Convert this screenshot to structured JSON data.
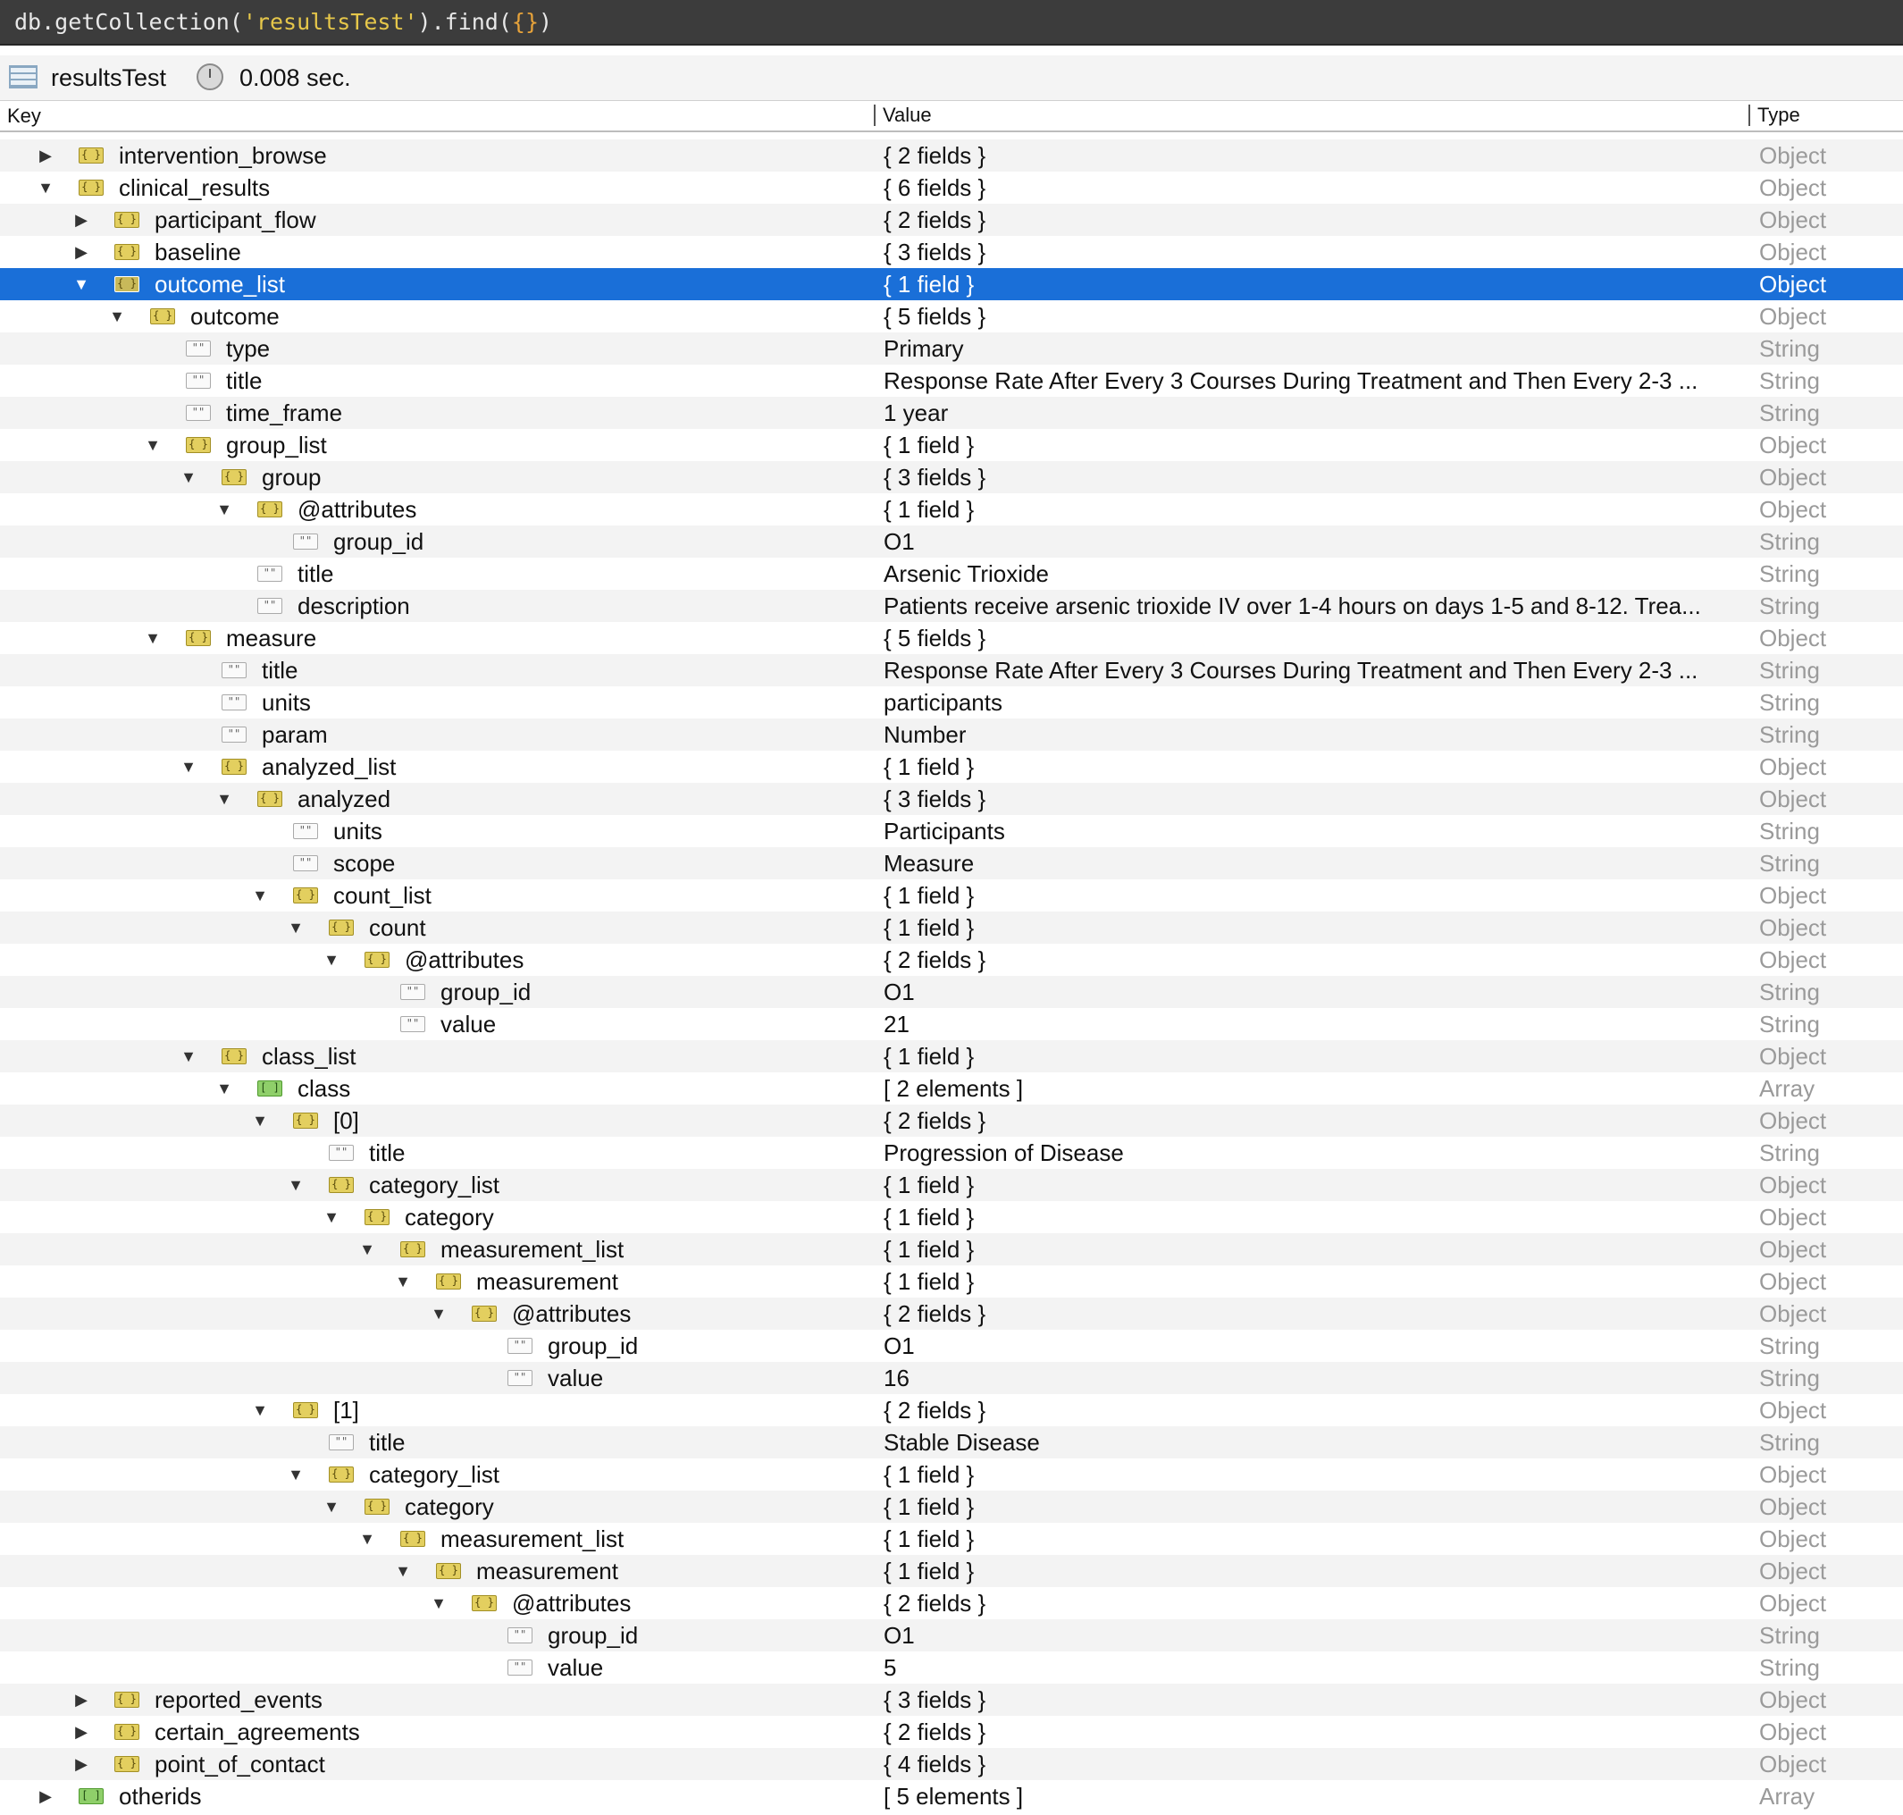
{
  "query": {
    "prefix": "db.getCollection(",
    "collection": "'resultsTest'",
    "suffix": ").find(",
    "braces": "{}",
    "close": ")"
  },
  "status": {
    "collection_name": "resultsTest",
    "elapsed": "0.008 sec."
  },
  "columns": {
    "key": "Key",
    "value": "Value",
    "type": "Type"
  },
  "rows": [
    {
      "key": "intervention_browse",
      "value": "{ 2 fields }",
      "type": "Object",
      "depth": 1,
      "kind": "object",
      "state": "collapsed"
    },
    {
      "key": "clinical_results",
      "value": "{ 6 fields }",
      "type": "Object",
      "depth": 1,
      "kind": "object",
      "state": "expanded"
    },
    {
      "key": "participant_flow",
      "value": "{ 2 fields }",
      "type": "Object",
      "depth": 2,
      "kind": "object",
      "state": "collapsed"
    },
    {
      "key": "baseline",
      "value": "{ 3 fields }",
      "type": "Object",
      "depth": 2,
      "kind": "object",
      "state": "collapsed"
    },
    {
      "key": "outcome_list",
      "value": "{ 1 field }",
      "type": "Object",
      "depth": 2,
      "kind": "object",
      "state": "expanded",
      "selected": true
    },
    {
      "key": "outcome",
      "value": "{ 5 fields }",
      "type": "Object",
      "depth": 3,
      "kind": "object",
      "state": "expanded"
    },
    {
      "key": "type",
      "value": "Primary",
      "type": "String",
      "depth": 4,
      "kind": "string",
      "state": "leaf"
    },
    {
      "key": "title",
      "value": "Response Rate After Every 3 Courses During Treatment and Then Every 2-3 ...",
      "type": "String",
      "depth": 4,
      "kind": "string",
      "state": "leaf"
    },
    {
      "key": "time_frame",
      "value": "1 year",
      "type": "String",
      "depth": 4,
      "kind": "string",
      "state": "leaf"
    },
    {
      "key": "group_list",
      "value": "{ 1 field }",
      "type": "Object",
      "depth": 4,
      "kind": "object",
      "state": "expanded"
    },
    {
      "key": "group",
      "value": "{ 3 fields }",
      "type": "Object",
      "depth": 5,
      "kind": "object",
      "state": "expanded"
    },
    {
      "key": "@attributes",
      "value": "{ 1 field }",
      "type": "Object",
      "depth": 6,
      "kind": "object",
      "state": "expanded"
    },
    {
      "key": "group_id",
      "value": "O1",
      "type": "String",
      "depth": 7,
      "kind": "string",
      "state": "leaf"
    },
    {
      "key": "title",
      "value": "Arsenic Trioxide",
      "type": "String",
      "depth": 6,
      "kind": "string",
      "state": "leaf"
    },
    {
      "key": "description",
      "value": "Patients receive arsenic trioxide IV over 1-4 hours on days 1-5 and 8-12. Trea...",
      "type": "String",
      "depth": 6,
      "kind": "string",
      "state": "leaf"
    },
    {
      "key": "measure",
      "value": "{ 5 fields }",
      "type": "Object",
      "depth": 4,
      "kind": "object",
      "state": "expanded"
    },
    {
      "key": "title",
      "value": "Response Rate After Every 3 Courses During Treatment and Then Every 2-3 ...",
      "type": "String",
      "depth": 5,
      "kind": "string",
      "state": "leaf"
    },
    {
      "key": "units",
      "value": "participants",
      "type": "String",
      "depth": 5,
      "kind": "string",
      "state": "leaf"
    },
    {
      "key": "param",
      "value": "Number",
      "type": "String",
      "depth": 5,
      "kind": "string",
      "state": "leaf"
    },
    {
      "key": "analyzed_list",
      "value": "{ 1 field }",
      "type": "Object",
      "depth": 5,
      "kind": "object",
      "state": "expanded"
    },
    {
      "key": "analyzed",
      "value": "{ 3 fields }",
      "type": "Object",
      "depth": 6,
      "kind": "object",
      "state": "expanded"
    },
    {
      "key": "units",
      "value": "Participants",
      "type": "String",
      "depth": 7,
      "kind": "string",
      "state": "leaf"
    },
    {
      "key": "scope",
      "value": "Measure",
      "type": "String",
      "depth": 7,
      "kind": "string",
      "state": "leaf"
    },
    {
      "key": "count_list",
      "value": "{ 1 field }",
      "type": "Object",
      "depth": 7,
      "kind": "object",
      "state": "expanded"
    },
    {
      "key": "count",
      "value": "{ 1 field }",
      "type": "Object",
      "depth": 8,
      "kind": "object",
      "state": "expanded"
    },
    {
      "key": "@attributes",
      "value": "{ 2 fields }",
      "type": "Object",
      "depth": 9,
      "kind": "object",
      "state": "expanded"
    },
    {
      "key": "group_id",
      "value": "O1",
      "type": "String",
      "depth": 10,
      "kind": "string",
      "state": "leaf"
    },
    {
      "key": "value",
      "value": "21",
      "type": "String",
      "depth": 10,
      "kind": "string",
      "state": "leaf"
    },
    {
      "key": "class_list",
      "value": "{ 1 field }",
      "type": "Object",
      "depth": 5,
      "kind": "object",
      "state": "expanded"
    },
    {
      "key": "class",
      "value": "[ 2 elements ]",
      "type": "Array",
      "depth": 6,
      "kind": "array",
      "state": "expanded"
    },
    {
      "key": "[0]",
      "value": "{ 2 fields }",
      "type": "Object",
      "depth": 7,
      "kind": "object",
      "state": "expanded"
    },
    {
      "key": "title",
      "value": "Progression of Disease",
      "type": "String",
      "depth": 8,
      "kind": "string",
      "state": "leaf"
    },
    {
      "key": "category_list",
      "value": "{ 1 field }",
      "type": "Object",
      "depth": 8,
      "kind": "object",
      "state": "expanded"
    },
    {
      "key": "category",
      "value": "{ 1 field }",
      "type": "Object",
      "depth": 9,
      "kind": "object",
      "state": "expanded"
    },
    {
      "key": "measurement_list",
      "value": "{ 1 field }",
      "type": "Object",
      "depth": 10,
      "kind": "object",
      "state": "expanded"
    },
    {
      "key": "measurement",
      "value": "{ 1 field }",
      "type": "Object",
      "depth": 11,
      "kind": "object",
      "state": "expanded"
    },
    {
      "key": "@attributes",
      "value": "{ 2 fields }",
      "type": "Object",
      "depth": 12,
      "kind": "object",
      "state": "expanded"
    },
    {
      "key": "group_id",
      "value": "O1",
      "type": "String",
      "depth": 13,
      "kind": "string",
      "state": "leaf"
    },
    {
      "key": "value",
      "value": "16",
      "type": "String",
      "depth": 13,
      "kind": "string",
      "state": "leaf"
    },
    {
      "key": "[1]",
      "value": "{ 2 fields }",
      "type": "Object",
      "depth": 7,
      "kind": "object",
      "state": "expanded"
    },
    {
      "key": "title",
      "value": "Stable Disease",
      "type": "String",
      "depth": 8,
      "kind": "string",
      "state": "leaf"
    },
    {
      "key": "category_list",
      "value": "{ 1 field }",
      "type": "Object",
      "depth": 8,
      "kind": "object",
      "state": "expanded"
    },
    {
      "key": "category",
      "value": "{ 1 field }",
      "type": "Object",
      "depth": 9,
      "kind": "object",
      "state": "expanded"
    },
    {
      "key": "measurement_list",
      "value": "{ 1 field }",
      "type": "Object",
      "depth": 10,
      "kind": "object",
      "state": "expanded"
    },
    {
      "key": "measurement",
      "value": "{ 1 field }",
      "type": "Object",
      "depth": 11,
      "kind": "object",
      "state": "expanded"
    },
    {
      "key": "@attributes",
      "value": "{ 2 fields }",
      "type": "Object",
      "depth": 12,
      "kind": "object",
      "state": "expanded"
    },
    {
      "key": "group_id",
      "value": "O1",
      "type": "String",
      "depth": 13,
      "kind": "string",
      "state": "leaf"
    },
    {
      "key": "value",
      "value": "5",
      "type": "String",
      "depth": 13,
      "kind": "string",
      "state": "leaf"
    },
    {
      "key": "reported_events",
      "value": "{ 3 fields }",
      "type": "Object",
      "depth": 2,
      "kind": "object",
      "state": "collapsed"
    },
    {
      "key": "certain_agreements",
      "value": "{ 2 fields }",
      "type": "Object",
      "depth": 2,
      "kind": "object",
      "state": "collapsed"
    },
    {
      "key": "point_of_contact",
      "value": "{ 4 fields }",
      "type": "Object",
      "depth": 2,
      "kind": "object",
      "state": "collapsed"
    },
    {
      "key": "otherids",
      "value": "[ 5 elements ]",
      "type": "Array",
      "depth": 1,
      "kind": "array",
      "state": "collapsed"
    }
  ]
}
